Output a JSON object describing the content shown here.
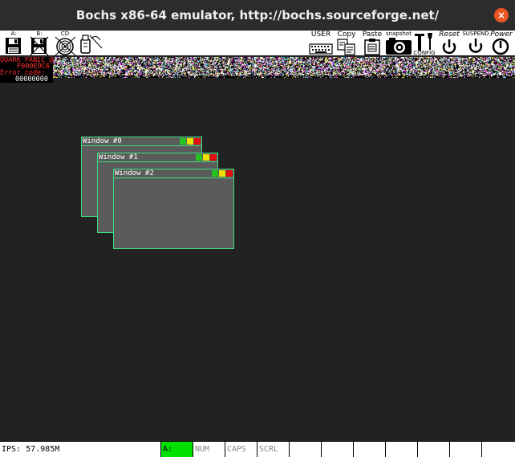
{
  "window": {
    "title": "Bochs x86-64 emulator, http://bochs.sourceforge.net/",
    "close_glyph": "×"
  },
  "toolbar": {
    "floppy_a_label": "A:",
    "floppy_b_label": "B:",
    "cdrom_label": "CD",
    "user_label": "USER",
    "copy_label": "Copy",
    "paste_label": "Paste",
    "snapshot_label": "snapshot",
    "config_label": "CONFIG",
    "reset_label": "Reset",
    "suspend_label": "SUSPEND",
    "power_label": "Power"
  },
  "screen": {
    "panic_lines": [
      "QUARK PANIC @",
      "F000E9C6",
      "Error code:",
      "00000000"
    ],
    "windows": [
      {
        "title": "Window #0"
      },
      {
        "title": "Window #1"
      },
      {
        "title": "Window #2"
      }
    ],
    "colors": {
      "background": "#222222",
      "window_fill": "#5b5b5b",
      "window_border": "#3ddc84",
      "btn_green": "#22c322",
      "btn_yellow": "#f0e000",
      "btn_red": "#e01010",
      "panic_text": "#ff3030"
    }
  },
  "statusbar": {
    "ips": "IPS: 57.985M",
    "drive": "A:",
    "num": "NUM",
    "caps": "CAPS",
    "scrl": "SCRL",
    "drive_color": "#00e000"
  }
}
